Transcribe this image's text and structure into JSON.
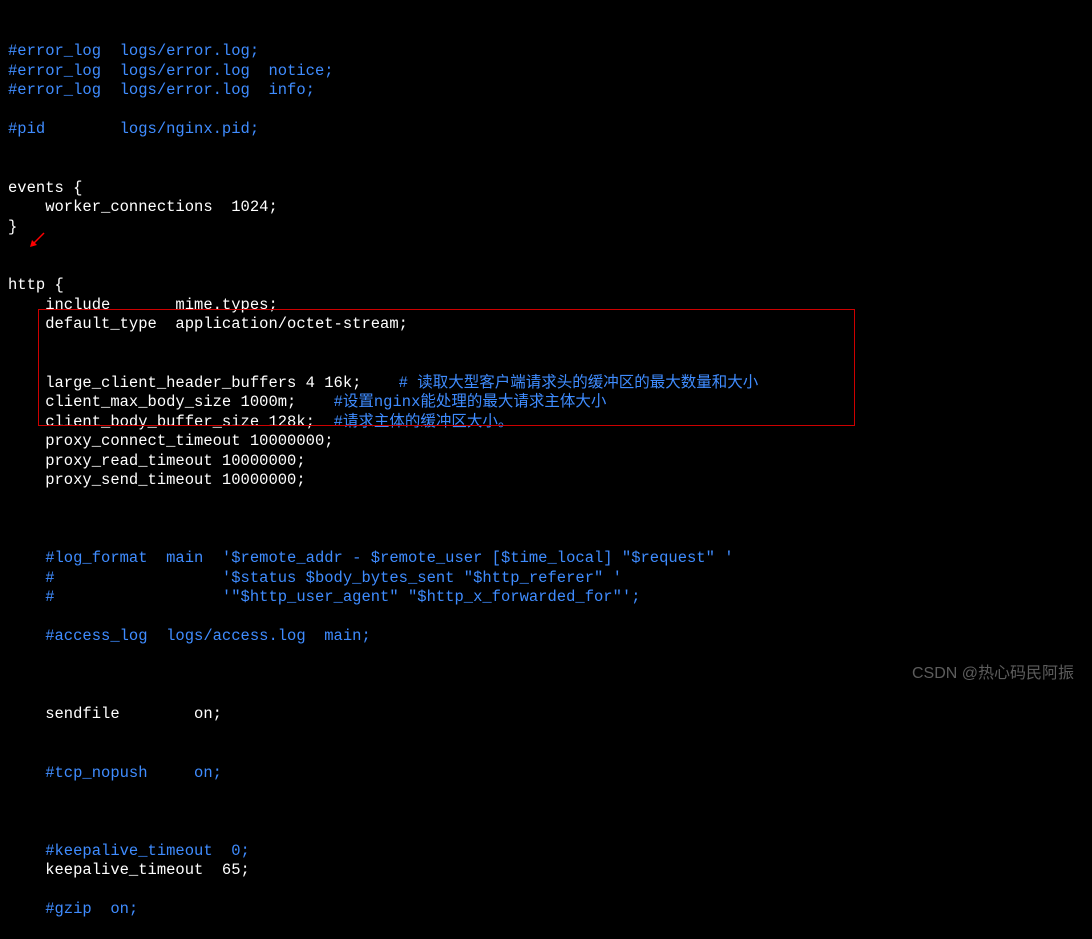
{
  "config": {
    "lines": [
      {
        "text": "#error_log  logs/error.log;",
        "color": "blue"
      },
      {
        "text": "#error_log  logs/error.log  notice;",
        "color": "blue"
      },
      {
        "text": "#error_log  logs/error.log  info;",
        "color": "blue"
      },
      {
        "text": "",
        "color": "white"
      },
      {
        "text": "#pid        logs/nginx.pid;",
        "color": "blue"
      },
      {
        "text": "",
        "color": "white"
      },
      {
        "text": "",
        "color": "white"
      },
      {
        "text": "events {",
        "color": "white"
      },
      {
        "text": "    worker_connections  1024;",
        "color": "white"
      },
      {
        "text": "}",
        "color": "white"
      },
      {
        "text": "",
        "color": "white"
      },
      {
        "text": "",
        "color": "white"
      },
      {
        "text": "http {",
        "color": "white"
      },
      {
        "text": "    include       mime.types;",
        "color": "white"
      },
      {
        "text": "    default_type  application/octet-stream;",
        "color": "white"
      }
    ],
    "highlighted": [
      {
        "prefix": "    large_client_header_buffers 4 16k;    ",
        "comment": "# 读取大型客户端请求头的缓冲区的最大数量和大小"
      },
      {
        "prefix": "    client_max_body_size 1000m;    ",
        "comment": "#设置nginx能处理的最大请求主体大小"
      },
      {
        "prefix": "    client_body_buffer_size 128k;  ",
        "comment": "#请求主体的缓冲区大小。"
      },
      {
        "prefix": "    proxy_connect_timeout 10000000;",
        "comment": ""
      },
      {
        "prefix": "    proxy_read_timeout 10000000;",
        "comment": ""
      },
      {
        "prefix": "    proxy_send_timeout 10000000;",
        "comment": ""
      }
    ],
    "after": [
      {
        "text": "",
        "color": "white"
      },
      {
        "text": "    #log_format  main  '$remote_addr - $remote_user [$time_local] \"$request\" '",
        "color": "blue"
      },
      {
        "text": "    #                  '$status $body_bytes_sent \"$http_referer\" '",
        "color": "blue"
      },
      {
        "text": "    #                  '\"$http_user_agent\" \"$http_x_forwarded_for\"';",
        "color": "blue"
      },
      {
        "text": "",
        "color": "white"
      },
      {
        "text": "    #access_log  logs/access.log  main;",
        "color": "blue"
      },
      {
        "text": "",
        "color": "white"
      }
    ],
    "sendfile": {
      "prefix": "    sendfile        ",
      "value": "on;"
    },
    "tcp_nopush": "    #tcp_nopush     on;",
    "after2": [
      {
        "text": "",
        "color": "white"
      },
      {
        "text": "    #keepalive_timeout  0;",
        "color": "blue"
      },
      {
        "text": "    keepalive_timeout  65;",
        "color": "white"
      },
      {
        "text": "",
        "color": "white"
      },
      {
        "text": "    #gzip  on;",
        "color": "blue"
      }
    ]
  },
  "watermark": "CSDN @热心码民阿振"
}
